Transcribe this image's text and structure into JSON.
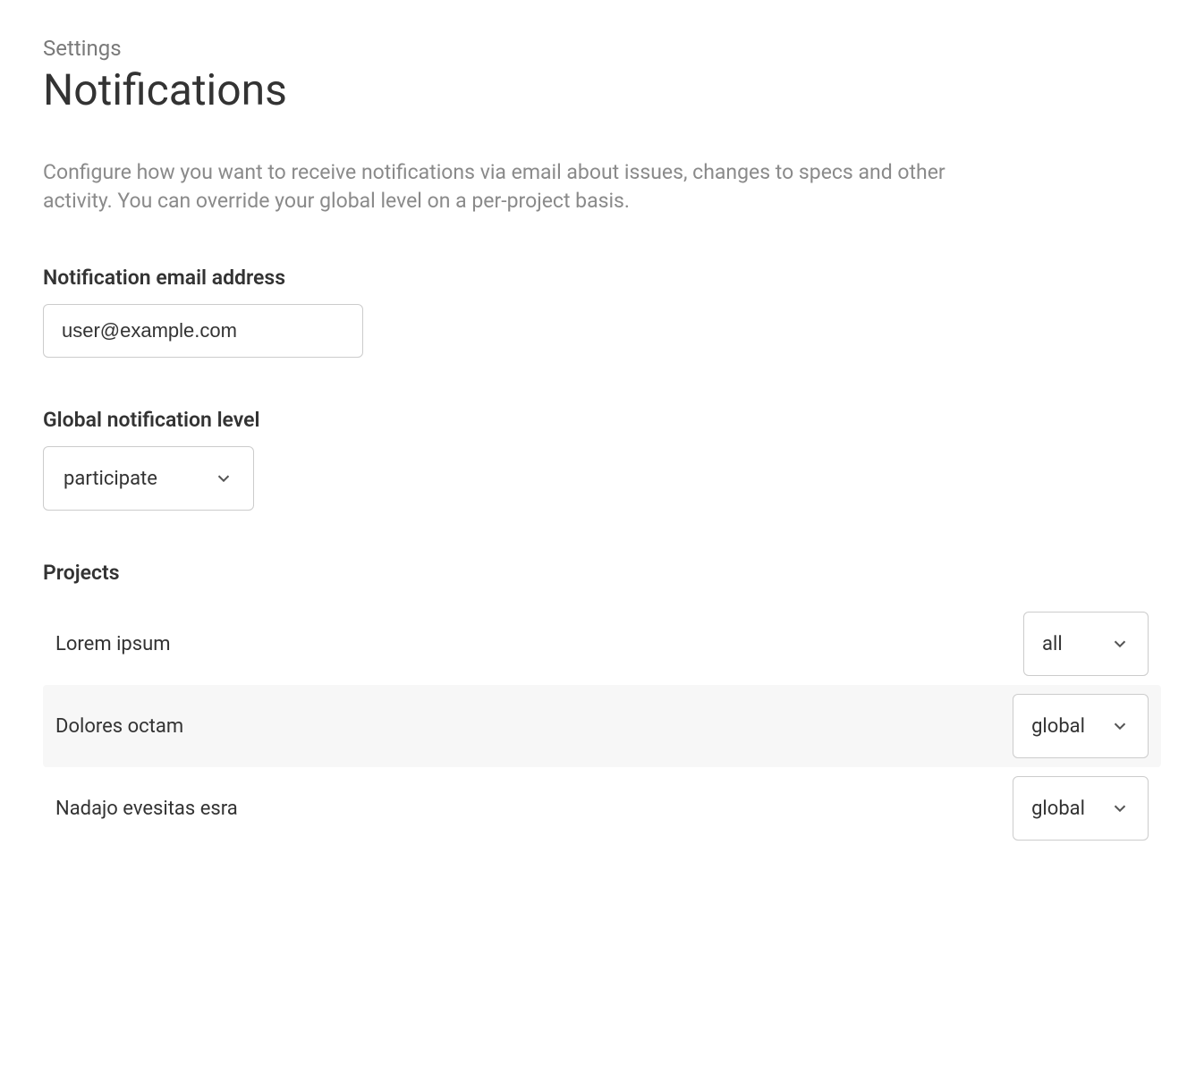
{
  "breadcrumb": "Settings",
  "title": "Notifications",
  "description": "Configure how you want to receive notifications via email about issues, changes to specs and other activity. You can override your global level on a per-project basis.",
  "email_section": {
    "label": "Notification email address",
    "value": "user@example.com"
  },
  "global_level_section": {
    "label": "Global notification level",
    "value": "participate"
  },
  "projects_section": {
    "label": "Projects",
    "items": [
      {
        "name": "Lorem ipsum",
        "level": "all",
        "highlighted": false
      },
      {
        "name": "Dolores octam",
        "level": "global",
        "highlighted": true
      },
      {
        "name": "Nadajo evesitas esra",
        "level": "global",
        "highlighted": false
      }
    ]
  }
}
